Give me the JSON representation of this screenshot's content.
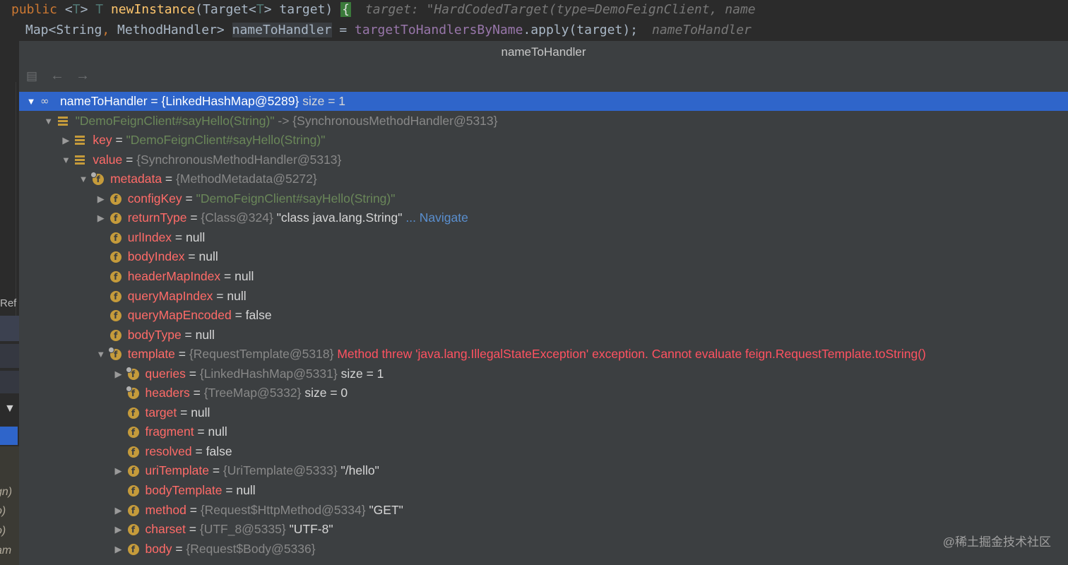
{
  "editor": {
    "line1": {
      "kw_public": "public",
      "lt1": "<",
      "type_T1": "T",
      "gt1": ">",
      "type_T2": "T",
      "method_name": "newInstance",
      "open_paren": "(Target",
      "lt2": "<",
      "type_T3": "T",
      "gt2": ">",
      "param": " target)",
      "brace": "{",
      "hint": "target: \"HardCodedTarget(type=DemoFeignClient, name"
    },
    "line2": {
      "decl": "Map<String",
      "comma": ",",
      "decl2": " MethodHandler> ",
      "var": "nameToHandler",
      "assign": " = ",
      "field": "targetToHandlersByName",
      "call": ".apply(target);",
      "hint": "nameToHandler"
    }
  },
  "left_panel": {
    "ref_label": "Ref",
    "frames": [
      "gn)",
      "o)",
      "o)",
      "am"
    ]
  },
  "popup": {
    "title": "nameToHandler",
    "toolbar": {
      "collapse_icon": "hierarchy-icon",
      "back_icon": "←",
      "forward_icon": "→"
    },
    "rows": [
      {
        "depth": 0,
        "toggle": "expanded",
        "icon": "watch",
        "name": "nameToHandler",
        "eq": " = ",
        "ref": "{LinkedHashMap@5289}",
        "value": "  size = 1",
        "selected": true
      },
      {
        "depth": 1,
        "toggle": "expanded",
        "icon": "entry",
        "str": "\"DemoFeignClient#sayHello(String)\"",
        "ref": " -> {SynchronousMethodHandler@5313}"
      },
      {
        "depth": 2,
        "toggle": "collapsed",
        "icon": "entry",
        "name": "key",
        "eq": " = ",
        "str": "\"DemoFeignClient#sayHello(String)\""
      },
      {
        "depth": 2,
        "toggle": "expanded",
        "icon": "entry",
        "name": "value",
        "eq": " = ",
        "ref": "{SynchronousMethodHandler@5313}"
      },
      {
        "depth": 3,
        "toggle": "expanded",
        "icon": "field-marked",
        "name": "metadata",
        "eq": " = ",
        "ref": "{MethodMetadata@5272}"
      },
      {
        "depth": 4,
        "toggle": "collapsed",
        "icon": "field",
        "name": "configKey",
        "eq": " = ",
        "str": "\"DemoFeignClient#sayHello(String)\""
      },
      {
        "depth": 4,
        "toggle": "collapsed",
        "icon": "field",
        "name": "returnType",
        "eq": " = ",
        "ref": "{Class@324}",
        "value": " \"class java.lang.String\"",
        "nav": " ... Navigate"
      },
      {
        "depth": 4,
        "toggle": "none",
        "icon": "field",
        "name": "urlIndex",
        "eq": " = ",
        "value": "null"
      },
      {
        "depth": 4,
        "toggle": "none",
        "icon": "field",
        "name": "bodyIndex",
        "eq": " = ",
        "value": "null"
      },
      {
        "depth": 4,
        "toggle": "none",
        "icon": "field",
        "name": "headerMapIndex",
        "eq": " = ",
        "value": "null"
      },
      {
        "depth": 4,
        "toggle": "none",
        "icon": "field",
        "name": "queryMapIndex",
        "eq": " = ",
        "value": "null"
      },
      {
        "depth": 4,
        "toggle": "none",
        "icon": "field",
        "name": "queryMapEncoded",
        "eq": " = ",
        "value": "false"
      },
      {
        "depth": 4,
        "toggle": "none",
        "icon": "field",
        "name": "bodyType",
        "eq": " = ",
        "value": "null"
      },
      {
        "depth": 4,
        "toggle": "expanded",
        "icon": "field-marked",
        "name": "template",
        "eq": " = ",
        "ref": "{RequestTemplate@5318}",
        "err": " Method threw 'java.lang.IllegalStateException' exception. Cannot evaluate feign.RequestTemplate.toString()"
      },
      {
        "depth": 5,
        "toggle": "collapsed",
        "icon": "field-marked",
        "name": "queries",
        "eq": " = ",
        "ref": "{LinkedHashMap@5331}",
        "value": "  size = 1"
      },
      {
        "depth": 5,
        "toggle": "none",
        "icon": "field-marked",
        "name": "headers",
        "eq": " = ",
        "ref": "{TreeMap@5332}",
        "value": "  size = 0"
      },
      {
        "depth": 5,
        "toggle": "none",
        "icon": "field",
        "name": "target",
        "eq": " = ",
        "value": "null"
      },
      {
        "depth": 5,
        "toggle": "none",
        "icon": "field",
        "name": "fragment",
        "eq": " = ",
        "value": "null"
      },
      {
        "depth": 5,
        "toggle": "none",
        "icon": "field",
        "name": "resolved",
        "eq": " = ",
        "value": "false"
      },
      {
        "depth": 5,
        "toggle": "collapsed",
        "icon": "field",
        "name": "uriTemplate",
        "eq": " = ",
        "ref": "{UriTemplate@5333}",
        "value": " \"/hello\""
      },
      {
        "depth": 5,
        "toggle": "none",
        "icon": "field",
        "name": "bodyTemplate",
        "eq": " = ",
        "value": "null"
      },
      {
        "depth": 5,
        "toggle": "collapsed",
        "icon": "field",
        "name": "method",
        "eq": " = ",
        "ref": "{Request$HttpMethod@5334}",
        "value": " \"GET\""
      },
      {
        "depth": 5,
        "toggle": "collapsed",
        "icon": "field",
        "name": "charset",
        "eq": " = ",
        "ref": "{UTF_8@5335}",
        "value": " \"UTF-8\""
      },
      {
        "depth": 5,
        "toggle": "collapsed",
        "icon": "field",
        "name": "body",
        "eq": " = ",
        "ref": "{Request$Body@5336}"
      }
    ]
  },
  "watermark": "@稀土掘金技术社区",
  "colors": {
    "selection": "#2f65ca",
    "field_name": "#ff6b68",
    "string": "#6a8759",
    "error": "#ff5261",
    "navigate": "#5a8fcf"
  }
}
